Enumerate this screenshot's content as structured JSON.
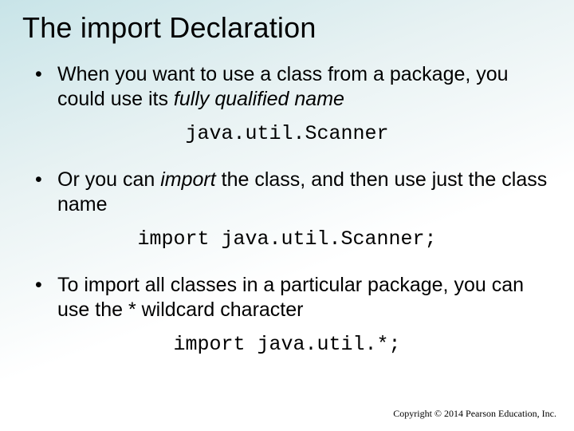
{
  "title": "The import Declaration",
  "bullets": {
    "b1": {
      "pre": "When you want to use a class from a package, you could use its ",
      "italic": "fully qualified name"
    },
    "code1": "java.util.Scanner",
    "b2": {
      "pre": "Or you can ",
      "italic": "import",
      "post": " the class, and then use just the class name"
    },
    "code2": "import java.util.Scanner;",
    "b3": {
      "text": "To import all classes in a particular package, you can use the * wildcard character"
    },
    "code3": "import java.util.*;"
  },
  "copyright": "Copyright © 2014 Pearson Education, Inc."
}
